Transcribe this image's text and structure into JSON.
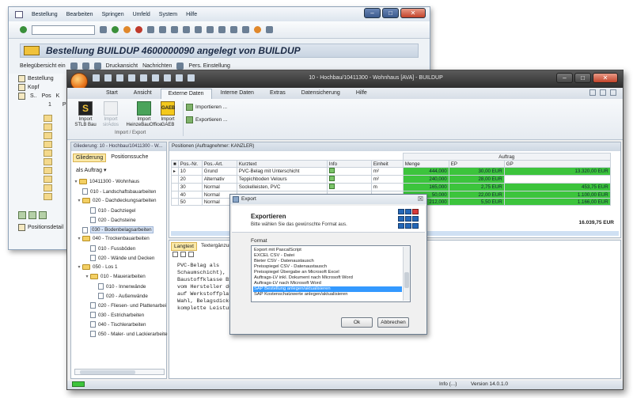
{
  "sap": {
    "menu": [
      "Bestellung",
      "Bearbeiten",
      "Springen",
      "Umfeld",
      "System",
      "Hilfe"
    ],
    "title": "Bestellung BUILDUP 4600000090 angelegt von BUILDUP",
    "appbar": [
      "Belegübersicht ein",
      "Druckansicht",
      "Nachrichten",
      "Pers. Einstellung"
    ],
    "left": {
      "header": "Bestellung",
      "kopf": "Kopf",
      "cols": [
        "S..",
        "Pos",
        "K"
      ],
      "row_pos": "1",
      "row_k": "P",
      "positionsdetail": "Positionsdetail"
    }
  },
  "bu": {
    "title": "10 - Hochbau/10411300 - Wohnhaus [AVA] - BUILDUP",
    "tabs": [
      "Start",
      "Ansicht",
      "Externe Daten",
      "Interne Daten",
      "Extras",
      "Datensicherung",
      "Hilfe"
    ],
    "active_tab": "Externe Daten",
    "ribbon": {
      "buttons": [
        {
          "line1": "Import",
          "line2": "STLB Bau",
          "icon": "stlb-icon"
        },
        {
          "line1": "Import",
          "line2": "sirAdos",
          "icon": "siraods-icon"
        },
        {
          "line1": "Import",
          "line2": "HeinzeBauOffice",
          "icon": "heinze-icon"
        },
        {
          "line1": "Import",
          "line2": "GAEB",
          "icon": "gaeb-icon"
        }
      ],
      "group_label": "Import / Export",
      "importieren": "Importieren ...",
      "exportieren": "Exportieren ..."
    },
    "tree": {
      "header": "Gliederung: 10 - Hochbau/10411300 - W...",
      "tabs": [
        "Gliederung",
        "Positionssuche"
      ],
      "sort": "als Auftrag",
      "items": [
        "10411300 - Wohnhaus",
        "010 - Landschaftsbauarbeiten",
        "020 - Dachdeckungsarbeiten",
        "010 - Dachziegel",
        "020 - Dachsteine",
        "030 - Bodenbelagsarbeiten",
        "040 - Trockenbauarbeiten",
        "010 - Fussböden",
        "020 - Wände und Decken",
        "050 - Los 1",
        "010 - Mauerarbeiten",
        "010 - Innenwände",
        "020 - Außenwände",
        "020 - Fliesen- und Plattenarbei",
        "030 - Estricharbeiten",
        "040 - Tischlerarbeiten",
        "050 - Maler- und Lackierarbeite"
      ]
    },
    "positions": {
      "header": "Positionen (Auftragnehmer: KANZLER)",
      "group_header": "Auftrag",
      "columns": [
        "Pos.-Nr.",
        "Pos.-Art.",
        "Kurztext",
        "Info",
        "Einheit",
        "Menge",
        "EP",
        "GP"
      ],
      "rows": [
        {
          "nr": "10",
          "art": "Grund",
          "text": "PVC-Belag mit Unterschicht",
          "einheit": "m²",
          "menge": "444,000",
          "ep": "30,00 EUR",
          "gp": "13.320,00 EUR"
        },
        {
          "nr": "20",
          "art": "Alternativ",
          "text": "Teppichboden Velours",
          "einheit": "m²",
          "menge": "240,000",
          "ep": "28,00 EUR",
          "gp": ""
        },
        {
          "nr": "30",
          "art": "Normal",
          "text": "Sockelleisten, PVC",
          "einheit": "m",
          "menge": "165,000",
          "ep": "2,75 EUR",
          "gp": "453,75 EUR"
        },
        {
          "nr": "40",
          "art": "Normal",
          "text": "",
          "einheit": "",
          "menge": "50,000",
          "ep": "22,00 EUR",
          "gp": "1.100,00 EUR"
        },
        {
          "nr": "50",
          "art": "Normal",
          "text": "",
          "einheit": "",
          "menge": "212,000",
          "ep": "5,50 EUR",
          "gp": "1.166,00 EUR"
        }
      ],
      "total": "16.039,75 EUR"
    },
    "text_panel": {
      "tabs": [
        "Langtext",
        "Textergänzung"
      ],
      "body": "PVC-Belag als\nSchaumschicht),\nBaustoffklasse B1,\nvom Hersteller de\nauf Werkstoffplatte\nWahl, Belagsdicke\nkomplette Leistung"
    },
    "status": {
      "info": "Info (...)",
      "version": "Version 14.0.1.0"
    }
  },
  "dialog": {
    "title": "Export",
    "heading": "Exportieren",
    "subheading": "Bitte wählen Sie das gewünschte Format aus.",
    "format_label": "Format",
    "formats": [
      "Export mit PascalScript",
      "EXCEL CSV - Datei",
      "Bieter CSV - Datenaustausch",
      "Preisspiegel CSV - Datenaustausch",
      "Preisspiegel Übergabe an Microsoft Excel",
      "Auftrags-LV inkl. Dokument nach Microsoft Word",
      "Auftrags-LV nach Microsoft Word",
      "SAP Bestellung anlegen/aktualisieren",
      "SAP Kostenschatzwerte anlegen/aktualisieren"
    ],
    "selected_index": 7,
    "ok": "Ok",
    "cancel": "Abbrechen"
  }
}
